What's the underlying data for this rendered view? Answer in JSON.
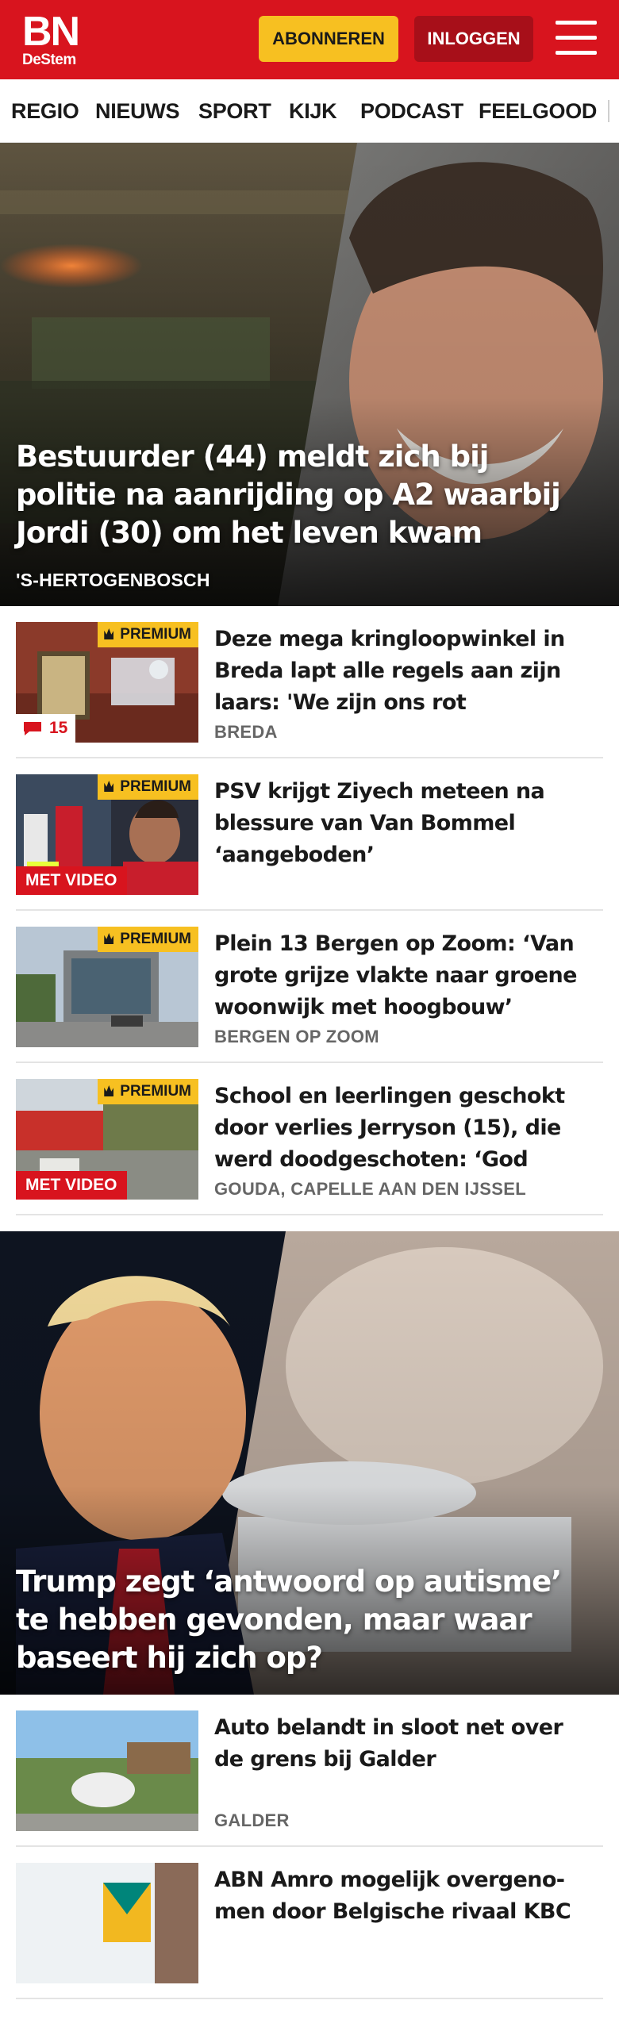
{
  "header": {
    "logo_main": "BN",
    "logo_sub": "DeStem",
    "subscribe_label": "ABONNEREN",
    "login_label": "INLOGGEN",
    "menu_icon": "hamburger-menu-icon",
    "brand_color": "#d8141e",
    "subscribe_color": "#f7c021"
  },
  "nav": {
    "items": [
      "REGIO",
      "NIEUWS",
      "SPORT",
      "KIJK",
      "PODCAST",
      "FEELGOOD"
    ]
  },
  "hero1": {
    "title": "Bestuurder (44) meldt zich bij politie na aanrijding op A2 waarbij Jordi (30) om het leven kwam",
    "place": "'S-HERTOGENBOSCH"
  },
  "articles": [
    {
      "title": "Deze mega kringloopwinkel in Breda lapt alle regels aan zijn laars: 'We zijn ons rot geschrok-…",
      "place": "BREDA",
      "premium": "PREMIUM",
      "comments": "15"
    },
    {
      "title": "PSV krijgt Ziyech meteen na blessure van Van Bommel ‘aangeboden’",
      "place": "",
      "premium": "PREMIUM",
      "video": "MET VIDEO"
    },
    {
      "title": "Plein 13 Bergen op Zoom: ‘Van grote grijze vlakte naar groene woonwijk met hoogbouw’",
      "place": "BERGEN OP ZOOM",
      "premium": "PREMIUM"
    },
    {
      "title": "School en leerlingen geschokt door verlies Jerryson (15), die werd doodgeschoten: ‘God had…",
      "place": "GOUDA, CAPELLE AAN DEN IJSSEL",
      "premium": "PREMIUM",
      "video": "MET VIDEO"
    }
  ],
  "hero2": {
    "title": "Trump zegt ‘antwoord op autisme’ te hebben gevonden, maar waar baseert hij zich op?"
  },
  "articles2": [
    {
      "title": "Auto belandt in sloot net over de grens bij Galder",
      "place": "GALDER"
    },
    {
      "title": "ABN Amro mogelijk overgeno­men door Belgische rivaal KBC",
      "place": ""
    }
  ]
}
